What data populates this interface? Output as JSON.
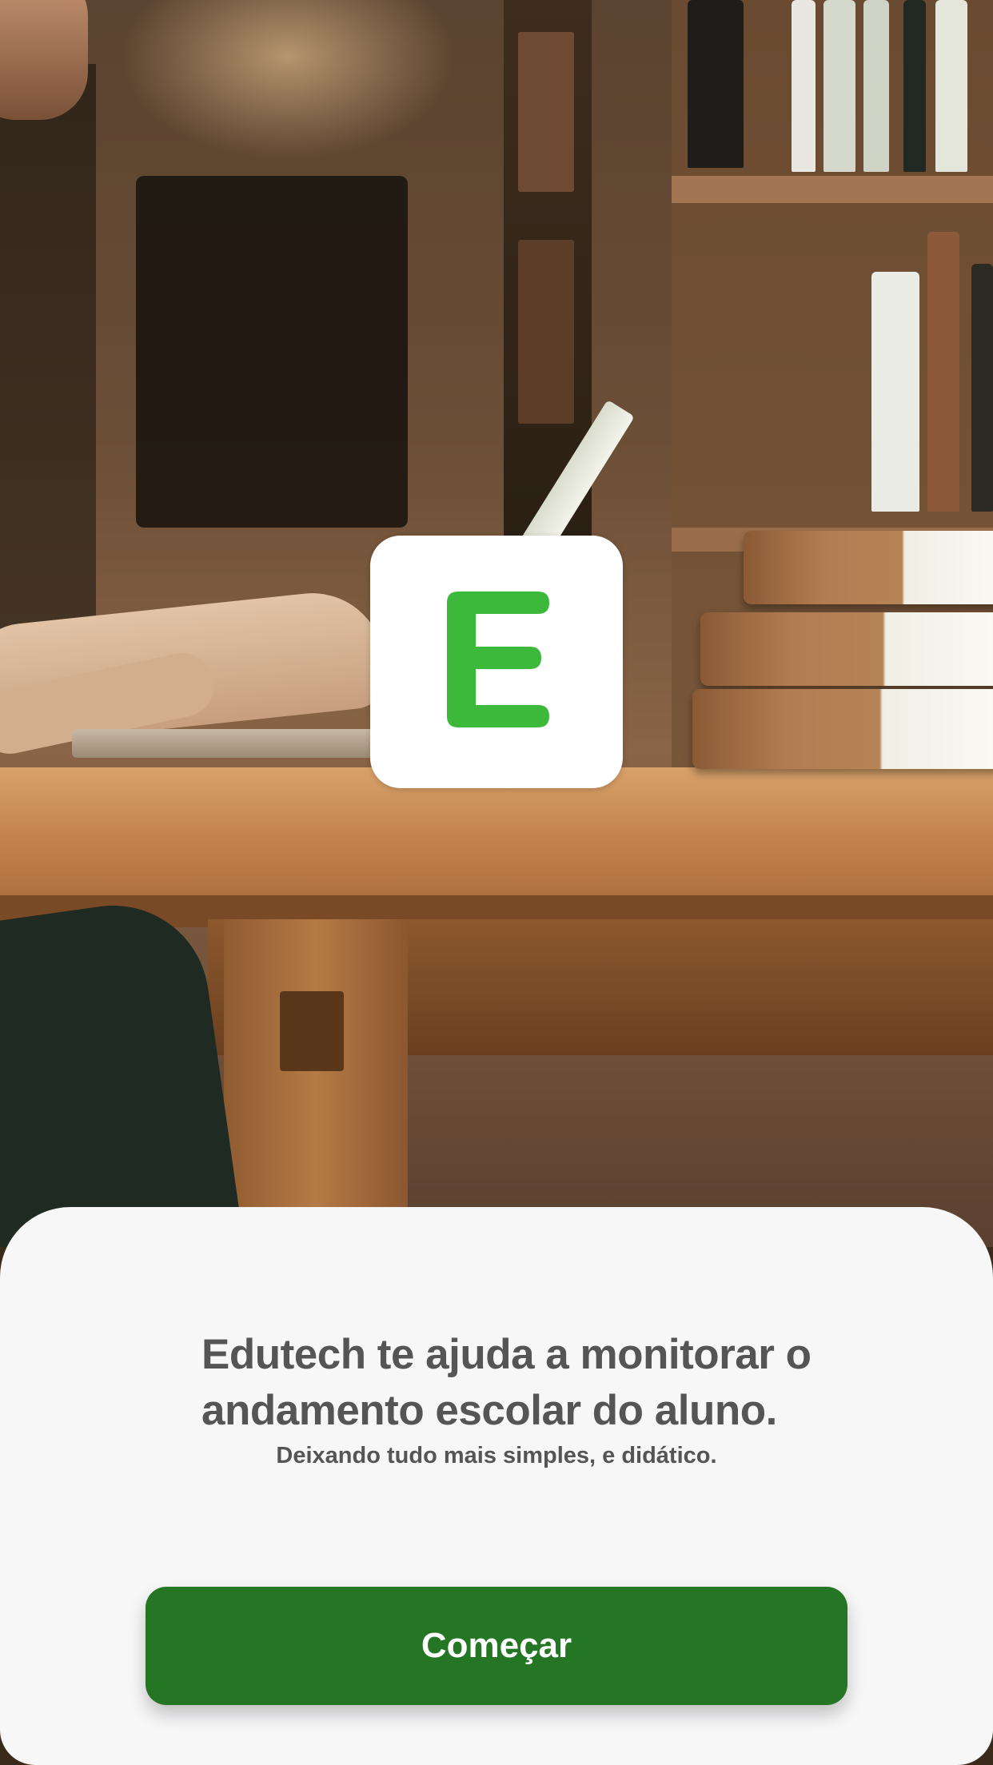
{
  "logo": {
    "letter": "E",
    "tile_color": "#ffffff",
    "letter_color": "#3cb93b"
  },
  "onboarding": {
    "headline": "Edutech te ajuda a monitorar o andamento escolar do aluno.",
    "subtitle": "Deixando tudo mais simples, e didático.",
    "start_button_label": "Começar"
  },
  "colors": {
    "button": "#247524",
    "sheet": "#f7f7f8",
    "text": "#555555"
  }
}
